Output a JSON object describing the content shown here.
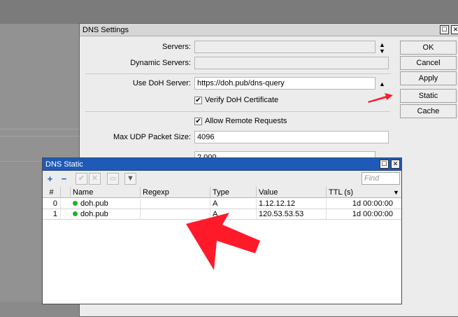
{
  "settings": {
    "title": "DNS Settings",
    "servers_label": "Servers:",
    "servers_value": "",
    "dynamic_servers_label": "Dynamic Servers:",
    "dynamic_servers_value": "",
    "doh_server_label": "Use DoH Server:",
    "doh_server_value": "https://doh.pub/dns-query",
    "verify_doh_label": "Verify DoH Certificate",
    "verify_doh_checked": true,
    "allow_remote_label": "Allow Remote Requests",
    "allow_remote_checked": true,
    "max_udp_label": "Max UDP Packet Size:",
    "max_udp_value": "4096",
    "hidden_row_value": "2.000",
    "buttons": {
      "ok": "OK",
      "cancel": "Cancel",
      "apply": "Apply",
      "static": "Static",
      "cache": "Cache"
    }
  },
  "static": {
    "title": "DNS Static",
    "find_placeholder": "Find",
    "columns": [
      "#",
      "Name",
      "Regexp",
      "Type",
      "Value",
      "TTL (s)"
    ],
    "rows": [
      {
        "index": "0",
        "name": "doh.pub",
        "regexp": "",
        "type": "A",
        "value": "1.12.12.12",
        "ttl": "1d 00:00:00"
      },
      {
        "index": "1",
        "name": "doh.pub",
        "regexp": "",
        "type": "A",
        "value": "120.53.53.53",
        "ttl": "1d 00:00:00"
      }
    ]
  },
  "colors": {
    "titlebar_active": "#1f5ab8",
    "status_enabled": "#1fb21f",
    "annotation_arrow": "#ff1a2a"
  }
}
